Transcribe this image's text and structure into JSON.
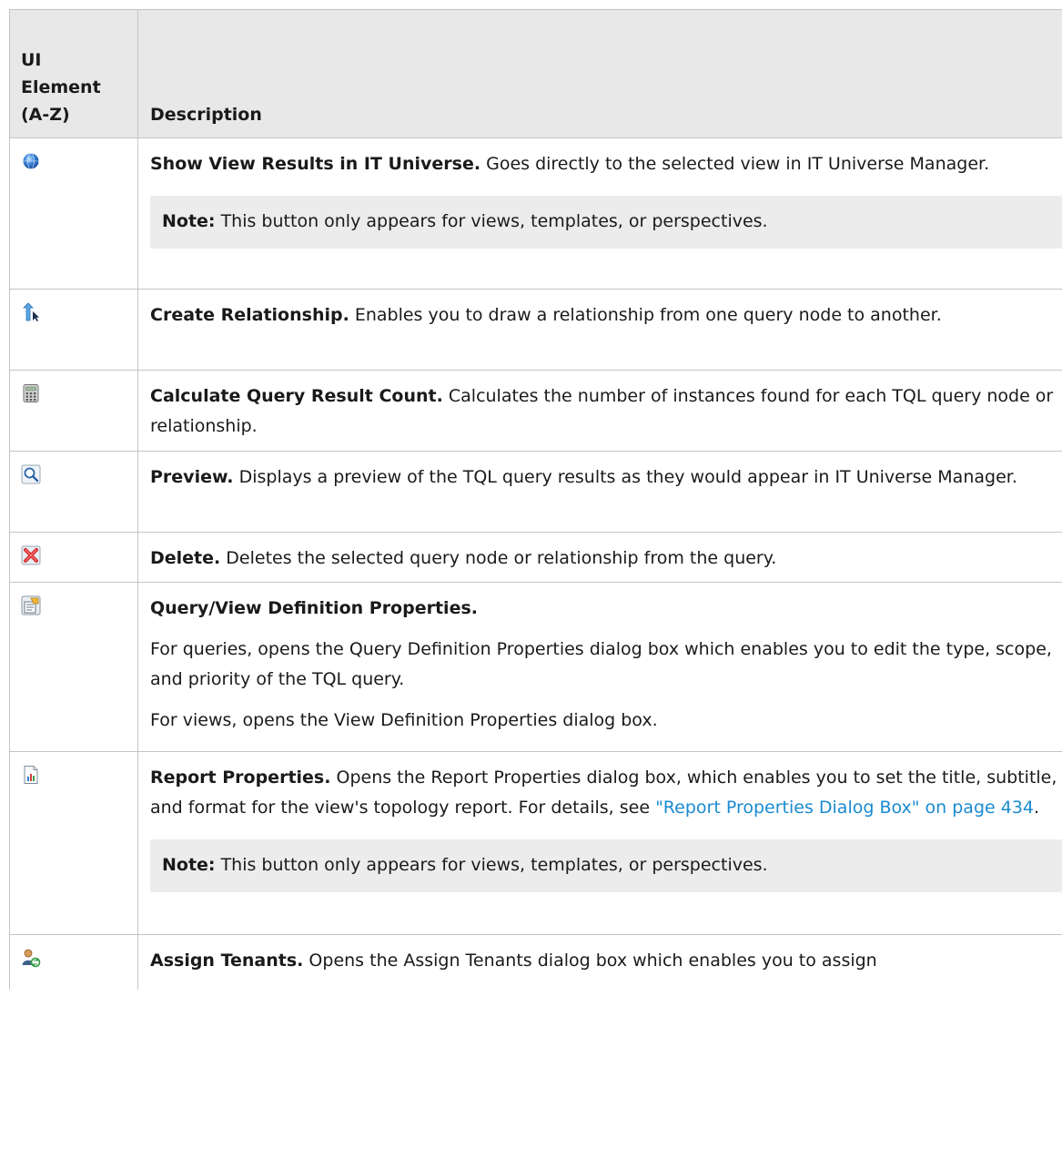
{
  "header": {
    "col1_line1": "UI",
    "col1_line2": "Element",
    "col1_line3": "(A-Z)",
    "col2": "Description"
  },
  "rows": [
    {
      "icon": "globe-icon",
      "title": "Show View Results in IT Universe.",
      "text": " Goes directly to the selected view in IT Universe Manager.",
      "note_label": "Note:",
      "note_text": " This button only appears for views, templates, or perspectives."
    },
    {
      "icon": "create-relationship-icon",
      "title": "Create Relationship.",
      "text": " Enables you to draw a relationship from one query node to another."
    },
    {
      "icon": "calculator-icon",
      "title": "Calculate Query Result Count.",
      "text": " Calculates the number of instances found for each TQL query node or relationship."
    },
    {
      "icon": "magnifier-icon",
      "title": "Preview.",
      "text": " Displays a preview of the TQL query results as they would appear in IT Universe Manager."
    },
    {
      "icon": "delete-icon",
      "title": "Delete.",
      "text": " Deletes the selected query node or relationship from the query."
    },
    {
      "icon": "properties-icon",
      "title": "Query/View Definition Properties.",
      "para1": "For queries, opens the Query Definition Properties dialog box which enables you to edit the type, scope, and priority of the TQL query.",
      "para2": "For views, opens the View Definition Properties dialog box."
    },
    {
      "icon": "report-icon",
      "title": "Report Properties.",
      "text": " Opens the Report Properties dialog box, which enables you to set the title, subtitle, and format for the view's topology report. For details, see ",
      "link": "\"Report Properties Dialog Box\" on page 434",
      "text_end": ".",
      "note_label": "Note:",
      "note_text": " This button only appears for views, templates, or perspectives."
    },
    {
      "icon": "assign-tenants-icon",
      "title": "Assign Tenants.",
      "text": " Opens the Assign Tenants dialog box which enables you to assign"
    }
  ]
}
